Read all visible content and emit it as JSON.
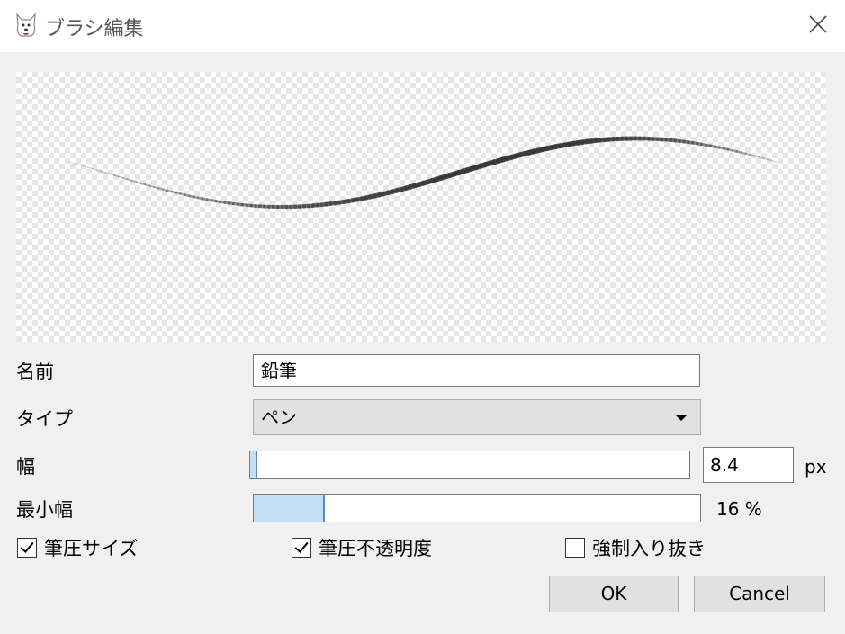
{
  "window": {
    "title": "ブラシ編集"
  },
  "icons": {
    "app": "dog-app-icon",
    "close": "close-icon",
    "dropdown": "triangle-down-icon",
    "check": "checkmark-icon"
  },
  "preview": {
    "stroke_color": "#2b2b2b"
  },
  "form": {
    "name": {
      "label": "名前",
      "value": "鉛筆"
    },
    "type": {
      "label": "タイプ",
      "selected": "ペン"
    },
    "width": {
      "label": "幅",
      "value": "8.4",
      "unit": "px",
      "fill_percent": 1
    },
    "min_width": {
      "label": "最小幅",
      "display": "16 %",
      "fill_percent": 16
    }
  },
  "options": [
    {
      "label": "筆圧サイズ",
      "checked": true
    },
    {
      "label": "筆圧不透明度",
      "checked": true
    },
    {
      "label": "強制入り抜き",
      "checked": false
    }
  ],
  "buttons": {
    "ok": "OK",
    "cancel": "Cancel"
  },
  "colors": {
    "dialog_bg": "#f0f0f0",
    "titlebar_bg": "#ffffff",
    "slider_fill": "#c3def3",
    "slider_edge": "#4a90d9"
  }
}
